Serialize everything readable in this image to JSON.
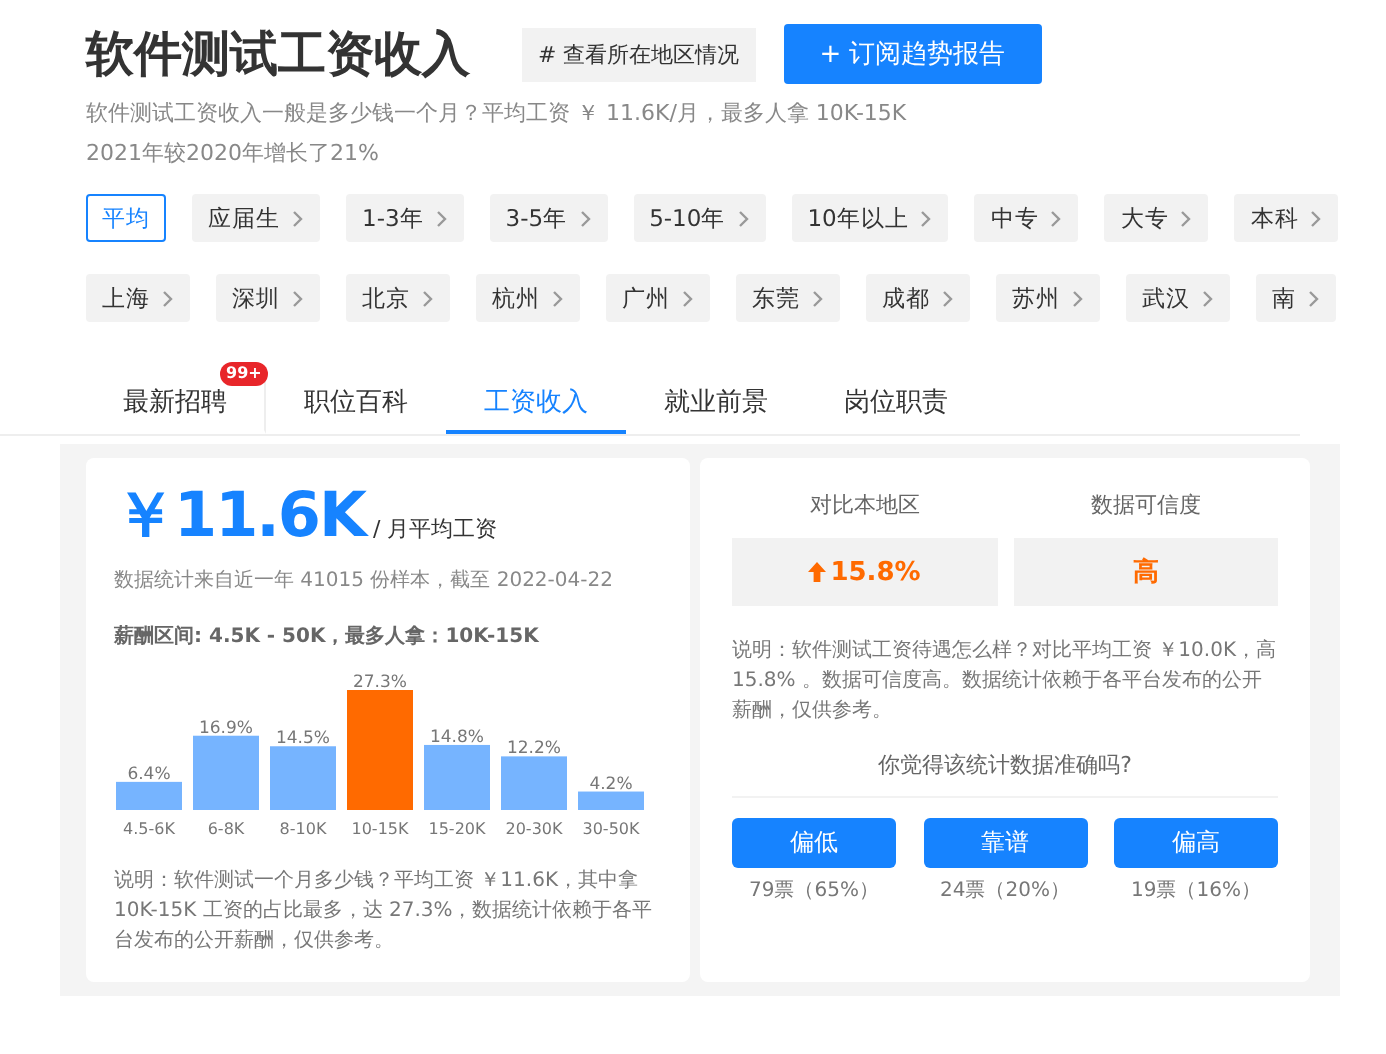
{
  "header": {
    "title": "软件测试工资收入",
    "region_button": "# 查看所在地区情况",
    "subscribe_button": "+ 订阅趋势报告"
  },
  "summary": [
    "软件测试工资收入一般是多少钱一个月？平均工资 ￥ 11.6K/月，最多人拿 10K-15K",
    "2021年较2020年增长了21%"
  ],
  "experience_filters": [
    {
      "label": "平均",
      "selected": true
    },
    {
      "label": "应届生",
      "selected": false
    },
    {
      "label": "1-3年",
      "selected": false
    },
    {
      "label": "3-5年",
      "selected": false
    },
    {
      "label": "5-10年",
      "selected": false
    },
    {
      "label": "10年以上",
      "selected": false
    },
    {
      "label": "中专",
      "selected": false
    },
    {
      "label": "大专",
      "selected": false
    },
    {
      "label": "本科",
      "selected": false
    }
  ],
  "city_filters": [
    {
      "label": "上海",
      "selected": false
    },
    {
      "label": "深圳",
      "selected": false
    },
    {
      "label": "北京",
      "selected": false
    },
    {
      "label": "杭州",
      "selected": false
    },
    {
      "label": "广州",
      "selected": false
    },
    {
      "label": "东莞",
      "selected": false
    },
    {
      "label": "成都",
      "selected": false
    },
    {
      "label": "苏州",
      "selected": false
    },
    {
      "label": "武汉",
      "selected": false
    },
    {
      "label": "南",
      "selected": false
    }
  ],
  "tabs": [
    {
      "label": "最新招聘",
      "badge": "99+",
      "selected": false
    },
    {
      "label": "职位百科",
      "selected": false
    },
    {
      "label": "工资收入",
      "selected": true
    },
    {
      "label": "就业前景",
      "selected": false
    },
    {
      "label": "岗位职责",
      "selected": false
    }
  ],
  "salary": {
    "amount": "￥11.6K",
    "unit": "/ 月平均工资",
    "source": "数据统计来自近一年 41015 份样本，截至 2022-04-22",
    "range": "薪酬区间: 4.5K - 50K，最多人拿：10K-15K",
    "chart_data": {
      "type": "bar",
      "categories": [
        "4.5-6K",
        "6-8K",
        "8-10K",
        "10-15K",
        "15-20K",
        "20-30K",
        "30-50K"
      ],
      "series": [
        {
          "color": "#76b4ff",
          "values": [
            6.4,
            16.9,
            14.5,
            null,
            14.8,
            12.2,
            4.2
          ],
          "value_labels": [
            "6.4%",
            "16.9%",
            "14.5%",
            null,
            "14.8%",
            "12.2%",
            "4.2%"
          ]
        },
        {
          "color": "#ff6a00",
          "values": [
            null,
            null,
            null,
            27.3,
            null,
            null,
            null
          ],
          "value_labels": [
            null,
            null,
            null,
            "27.3%",
            null,
            null,
            null
          ]
        }
      ],
      "data_labels": true
    },
    "note": "说明：软件测试一个月多少钱？平均工资 ￥11.6K，其中拿 10K-15K 工资的占比最多，达 27.3%，数据统计依赖于各平台发布的公开薪酬，仅供参考。"
  },
  "comparison": {
    "stats": [
      {
        "kind": "increase",
        "label": "对比本地区",
        "value": "15.8%"
      },
      {
        "kind": "plain",
        "label": "数据可信度",
        "value": "高"
      }
    ],
    "note": "说明：软件测试工资待遇怎么样？对比平均工资 ￥10.0K，高 15.8% 。数据可信度高。数据统计依赖于各平台发布的公开薪酬，仅供参考。",
    "question": "你觉得该统计数据准确吗?",
    "votes": [
      {
        "label": "偏低",
        "count": "79票（65%）"
      },
      {
        "label": "靠谱",
        "count": "24票（20%）"
      },
      {
        "label": "偏高",
        "count": "19票（16%）"
      }
    ]
  }
}
